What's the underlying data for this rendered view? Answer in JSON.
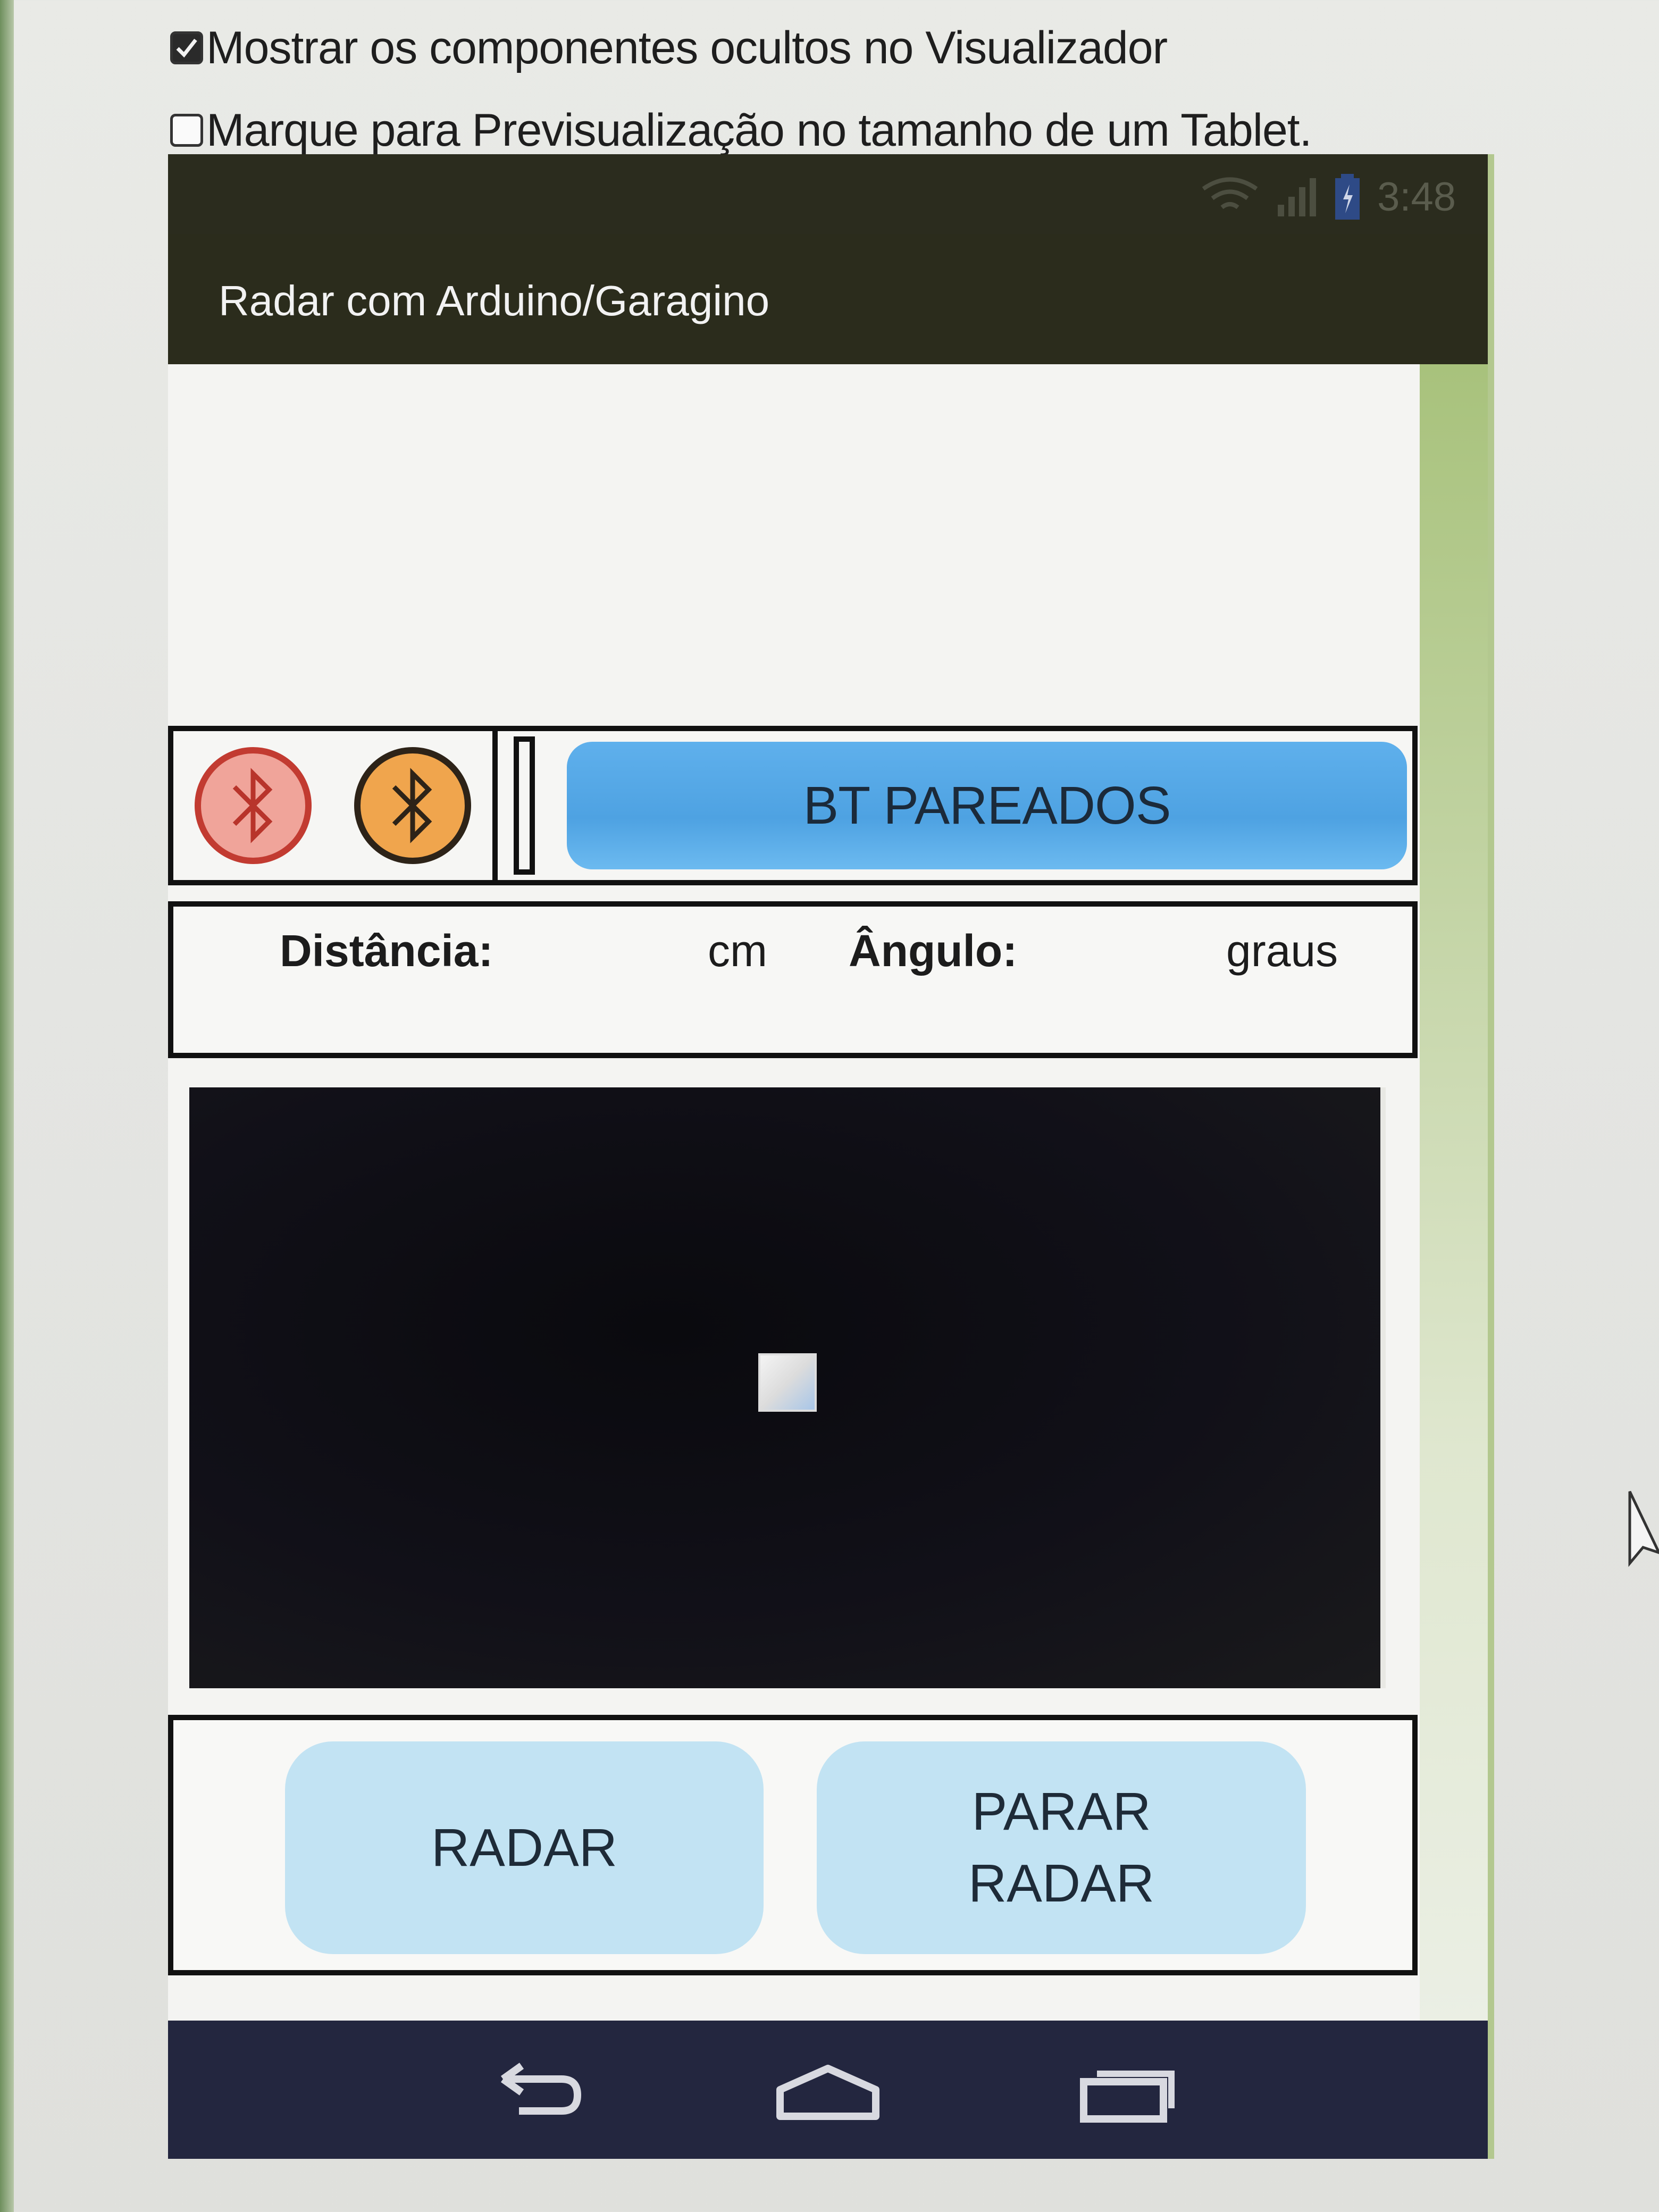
{
  "designer": {
    "show_hidden_checkbox": {
      "label": "Mostrar os componentes ocultos no Visualizador",
      "checked": true
    },
    "tablet_preview_checkbox": {
      "label": "Marque para Previsualização no tamanho de um Tablet.",
      "checked": false
    }
  },
  "status_bar": {
    "icons": [
      "wifi-icon",
      "signal-icon",
      "battery-icon"
    ],
    "time": "3:48"
  },
  "app": {
    "title": "Radar com Arduino/Garagino"
  },
  "bluetooth_row": {
    "icons": [
      "bluetooth-disconnected-icon",
      "bluetooth-connected-icon"
    ],
    "button_label": "BT PAREADOS"
  },
  "readout": {
    "distance_label": "Distância:",
    "distance_unit": "cm",
    "angle_label": "Ângulo:",
    "angle_unit": "graus"
  },
  "canvas": {
    "placeholder_icon": "image-placeholder-icon"
  },
  "radar_buttons": {
    "start_label": "RADAR",
    "stop_label": "PARAR RADAR"
  },
  "nav_bar": {
    "icons": [
      "back-icon",
      "home-icon",
      "recent-apps-icon"
    ]
  },
  "colors": {
    "app_bar": "#2b2c1c",
    "bt_button": "#4ea2e2",
    "radar_button": "#c2e3f3",
    "nav_bar": "#23263f",
    "bt_red": "#c23b31",
    "bt_orange": "#f0a54d"
  }
}
